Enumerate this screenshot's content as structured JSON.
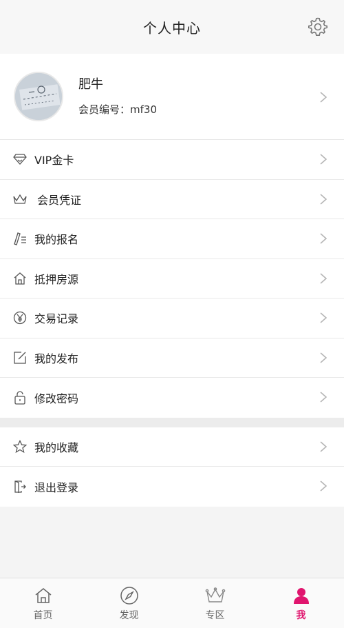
{
  "header": {
    "title": "个人中心",
    "settings_icon": "gear-icon"
  },
  "profile": {
    "name": "肥牛",
    "member_label": "会员编号：",
    "member_id": "mf30"
  },
  "menu_groups": [
    [
      {
        "label": "VIP金卡",
        "icon": "diamond-icon"
      },
      {
        "label": "会员凭证",
        "icon": "crown-icon"
      },
      {
        "label": "我的报名",
        "icon": "edit-list-icon"
      },
      {
        "label": "抵押房源",
        "icon": "house-icon"
      },
      {
        "label": "交易记录",
        "icon": "yen-icon"
      },
      {
        "label": "我的发布",
        "icon": "compose-icon"
      },
      {
        "label": "修改密码",
        "icon": "lock-icon"
      }
    ],
    [
      {
        "label": "我的收藏",
        "icon": "star-icon"
      },
      {
        "label": "退出登录",
        "icon": "logout-icon"
      }
    ]
  ],
  "bottom_nav": [
    {
      "label": "首页",
      "icon": "home-icon",
      "active": false
    },
    {
      "label": "发现",
      "icon": "compass-icon",
      "active": false
    },
    {
      "label": "专区",
      "icon": "crown-icon",
      "active": false
    },
    {
      "label": "我",
      "icon": "user-icon",
      "active": true
    }
  ],
  "colors": {
    "accent": "#e0156e",
    "icon_gray": "#666666"
  }
}
